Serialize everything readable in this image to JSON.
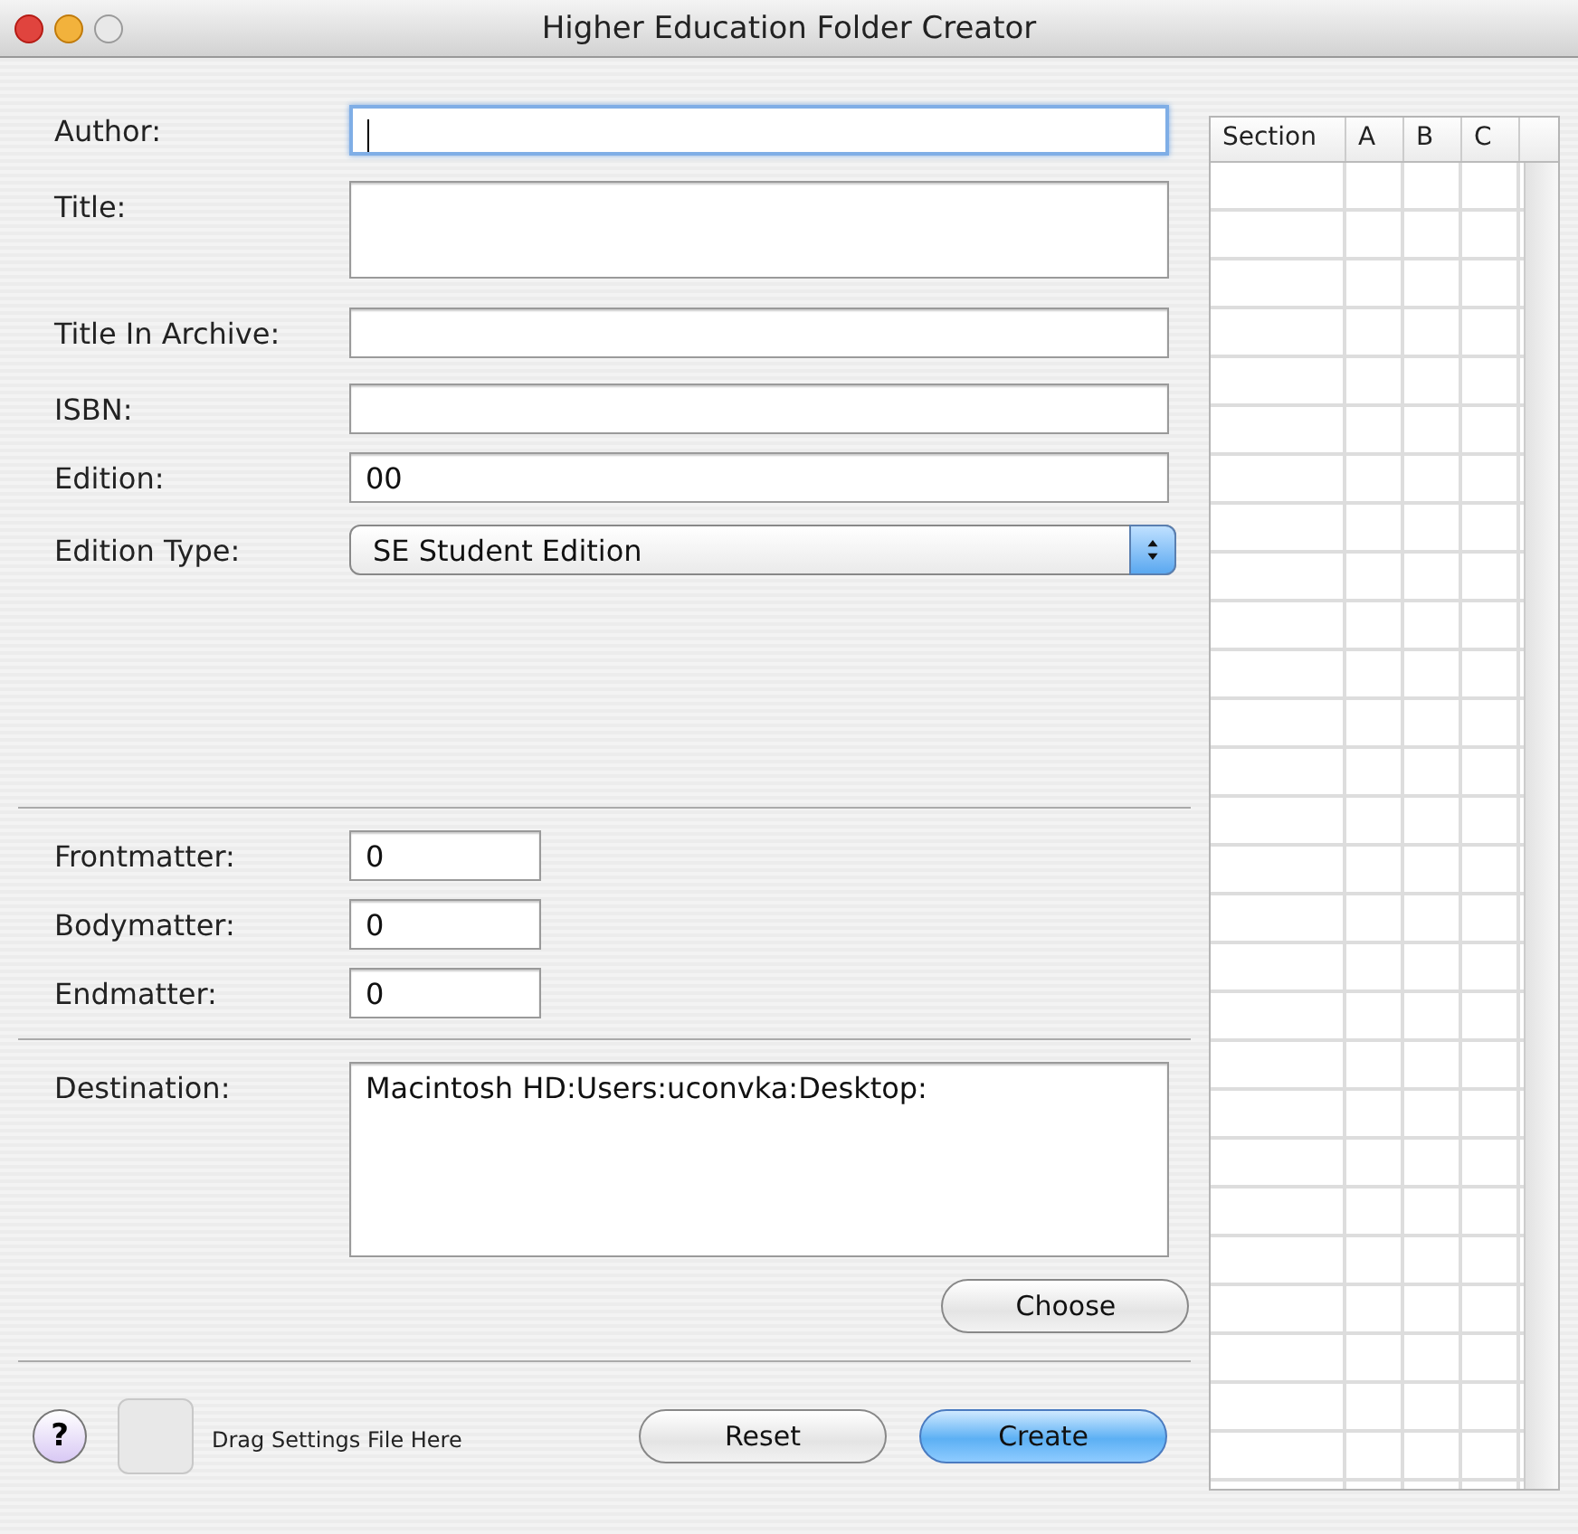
{
  "window": {
    "title": "Higher Education Folder Creator"
  },
  "book_fields": [
    {
      "label": "Author:",
      "kind": "text",
      "focused": true
    },
    {
      "label": "Title:",
      "kind": "textarea",
      "focused": false
    },
    {
      "label": "Title In Archive:",
      "kind": "text",
      "focused": false
    },
    {
      "label": "ISBN:",
      "kind": "text",
      "focused": false
    },
    {
      "label": "Edition:",
      "kind": "text",
      "value": "00",
      "focused": false
    },
    {
      "label": "Edition Type:",
      "kind": "popup",
      "value": "SE Student Edition"
    }
  ],
  "page_counts": [
    {
      "label": "Frontmatter:",
      "value": "0"
    },
    {
      "label": "Bodymatter:",
      "value": "0"
    },
    {
      "label": "Endmatter:",
      "value": "0"
    }
  ],
  "destination": {
    "label": "Destination:",
    "value": "Macintosh HD:Users:uconvka:Desktop:",
    "button": "Choose"
  },
  "footer": {
    "drop_hint": "Drag Settings File Here",
    "help": "?",
    "buttons": [
      {
        "label": "Reset",
        "kind": "normal"
      },
      {
        "label": "Create",
        "kind": "default"
      }
    ]
  },
  "table": {
    "columns": [
      "Section",
      "A",
      "B",
      "C"
    ]
  }
}
